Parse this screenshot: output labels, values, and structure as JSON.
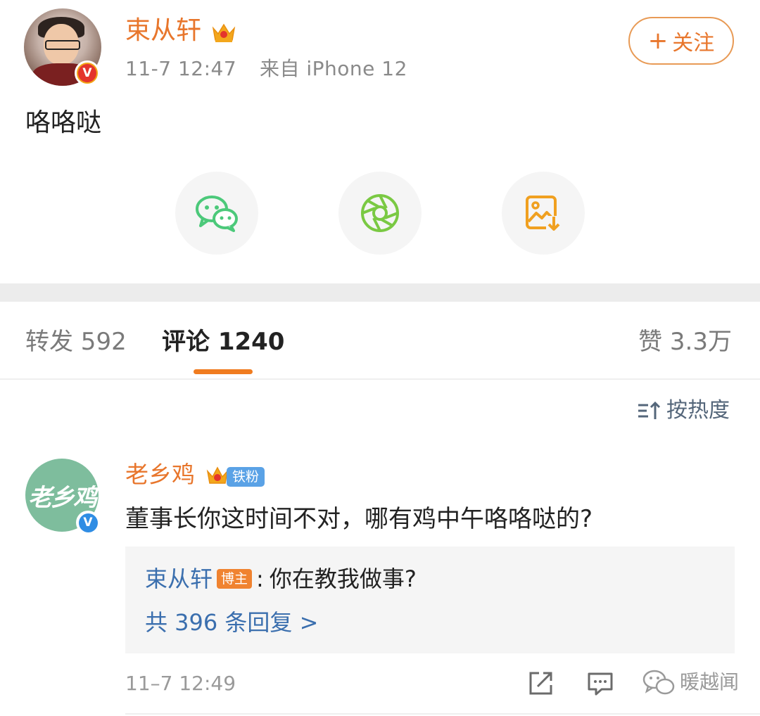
{
  "post": {
    "author": "束从轩",
    "verified_badge": "V",
    "time": "11-7 12:47",
    "source": "来自 iPhone 12",
    "follow_label": "关注",
    "follow_plus": "+",
    "content": "咯咯哒"
  },
  "share": {
    "icons": [
      "wechat-icon",
      "moments-icon",
      "save-image-icon"
    ]
  },
  "tabs": {
    "repost": "转发 592",
    "comments": "评论 1240",
    "likes": "赞 3.3万"
  },
  "sort": {
    "label": "按热度"
  },
  "comment": {
    "avatar_text": "老乡鸡",
    "user": "老乡鸡",
    "fan_badge": "铁粉",
    "text": "董事长你这时间不对，哪有鸡中午咯咯哒的?",
    "reply": {
      "author": "束从轩",
      "author_badge": "博主",
      "separator": ":",
      "text": "你在教我做事?"
    },
    "reply_count": "共 396 条回复 >",
    "time": "11–7 12:49"
  },
  "watermark": "暖越闻",
  "colors": {
    "accent_orange": "#e8762c",
    "link_blue": "#3b6fae",
    "wechat_green": "#4cc97a",
    "moments_green": "#7ac943",
    "save_orange": "#f0a020"
  }
}
